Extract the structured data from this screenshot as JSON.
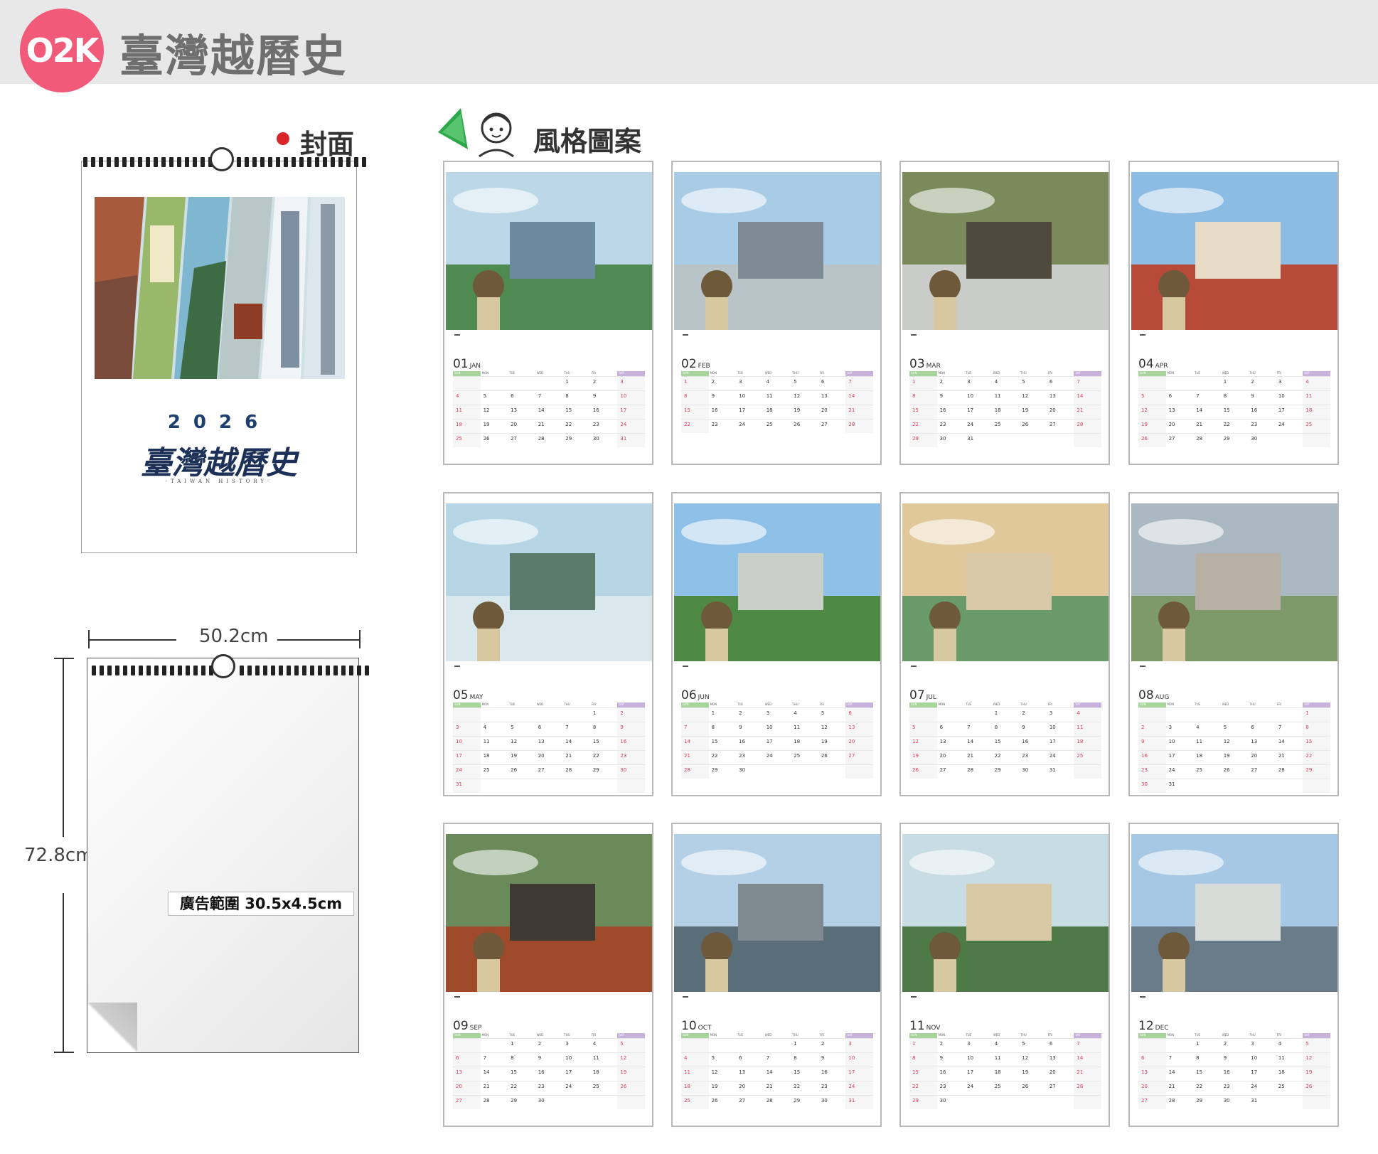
{
  "header": {
    "badge": "O2K",
    "title": "臺灣越曆史"
  },
  "cover_section": {
    "label": "封面"
  },
  "style_section": {
    "label": "風格圖案"
  },
  "cover": {
    "year": "2026",
    "title": "臺灣越曆史",
    "subtitle": "·TAIWAN HISTORY·"
  },
  "dimensions": {
    "width_label": "50.2cm",
    "height_label": "72.8cm",
    "ad_area": "廣告範圍 30.5x4.5cm"
  },
  "months": [
    {
      "num": "01",
      "abbr": "JAN",
      "offset": 4,
      "days": 31
    },
    {
      "num": "02",
      "abbr": "FEB",
      "offset": 0,
      "days": 28
    },
    {
      "num": "03",
      "abbr": "MAR",
      "offset": 0,
      "days": 31
    },
    {
      "num": "04",
      "abbr": "APR",
      "offset": 3,
      "days": 30
    },
    {
      "num": "05",
      "abbr": "MAY",
      "offset": 5,
      "days": 31
    },
    {
      "num": "06",
      "abbr": "JUN",
      "offset": 1,
      "days": 30
    },
    {
      "num": "07",
      "abbr": "JUL",
      "offset": 3,
      "days": 31
    },
    {
      "num": "08",
      "abbr": "AUG",
      "offset": 6,
      "days": 31
    },
    {
      "num": "09",
      "abbr": "SEP",
      "offset": 2,
      "days": 30
    },
    {
      "num": "10",
      "abbr": "OCT",
      "offset": 4,
      "days": 31
    },
    {
      "num": "11",
      "abbr": "NOV",
      "offset": 0,
      "days": 30
    },
    {
      "num": "12",
      "abbr": "DEC",
      "offset": 2,
      "days": 31
    }
  ],
  "weekdays": [
    "SUN",
    "MON",
    "TUE",
    "WED",
    "THU",
    "FRI",
    "SAT"
  ],
  "colors": {
    "badge": "#f25a7a",
    "header_bg": "#e8e8e8",
    "title_gray": "#6f6f6f",
    "cover_title": "#1c3058",
    "red_dot": "#d8262b"
  }
}
